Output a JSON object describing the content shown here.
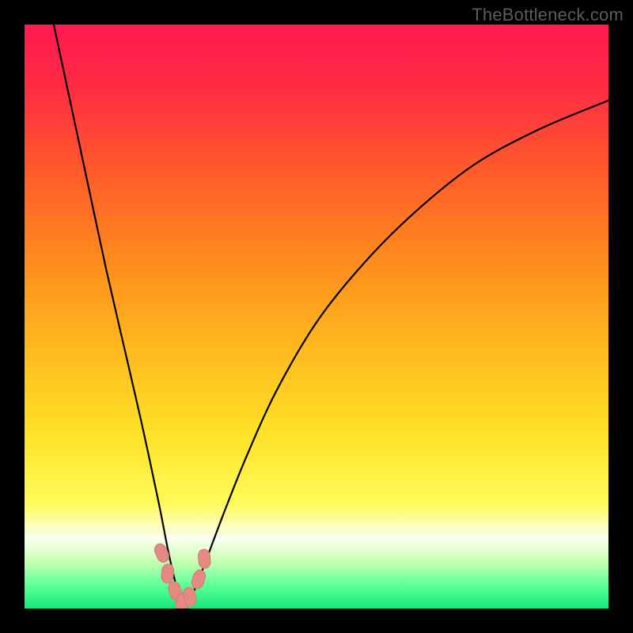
{
  "watermark": "TheBottleneck.com",
  "colors": {
    "frame": "#000000",
    "gradient_stops": [
      {
        "offset": 0.0,
        "color": "#ff1a52"
      },
      {
        "offset": 0.1,
        "color": "#ff2a45"
      },
      {
        "offset": 0.25,
        "color": "#ff5a2a"
      },
      {
        "offset": 0.4,
        "color": "#ff8a1e"
      },
      {
        "offset": 0.55,
        "color": "#ffb71e"
      },
      {
        "offset": 0.7,
        "color": "#ffe126"
      },
      {
        "offset": 0.82,
        "color": "#fffb5a"
      },
      {
        "offset": 0.88,
        "color": "#fafff0"
      },
      {
        "offset": 0.92,
        "color": "#c7ffb0"
      },
      {
        "offset": 0.96,
        "color": "#5cff9a"
      },
      {
        "offset": 1.0,
        "color": "#17e87a"
      }
    ],
    "curve": "#000000",
    "marker_fill": "#e58a82",
    "marker_stroke": "#d47a72"
  },
  "chart_data": {
    "type": "line",
    "title": "",
    "xlabel": "",
    "ylabel": "",
    "xlim": [
      0,
      100
    ],
    "ylim": [
      0,
      100
    ],
    "note": "V-shaped bottleneck curve. y represents mismatch/bottleneck percentage (0 = ideal, at bottom green band). Minimum around x≈27.",
    "series": [
      {
        "name": "bottleneck-curve",
        "x": [
          5,
          8,
          11,
          14,
          17,
          20,
          23,
          25,
          27,
          29,
          31,
          34,
          38,
          43,
          50,
          58,
          67,
          77,
          88,
          100
        ],
        "y": [
          100,
          86,
          72,
          58,
          45,
          32,
          18,
          8,
          1,
          3,
          8,
          16,
          26,
          37,
          49,
          59,
          68,
          76,
          82,
          87
        ]
      }
    ],
    "markers": {
      "name": "highlight-points",
      "x": [
        23.5,
        24.5,
        25.8,
        27.0,
        28.3,
        29.8,
        30.8
      ],
      "y": [
        9.5,
        6.0,
        3.0,
        1.0,
        2.0,
        5.0,
        8.5
      ]
    }
  }
}
